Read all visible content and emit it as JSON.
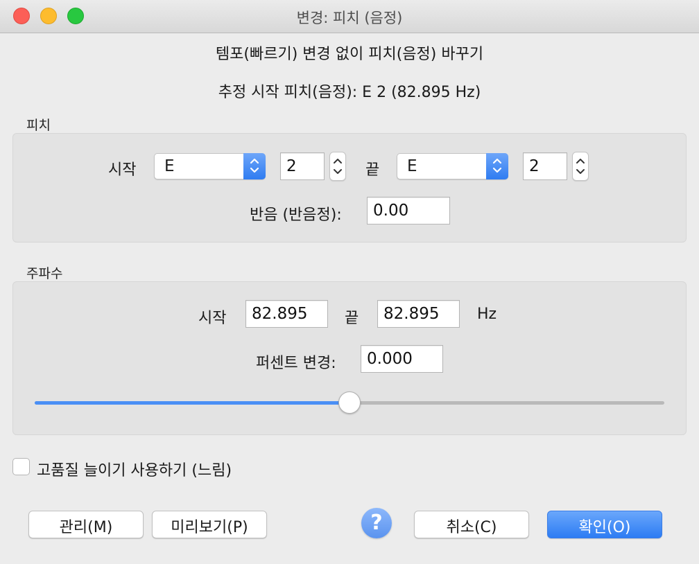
{
  "window": {
    "title": "변경: 피치 (음정)"
  },
  "header": {
    "description": "템포(빠르기) 변경 없이 피치(음정) 바꾸기",
    "estimated_start": "추정 시작 피치(음정): E 2 (82.895 Hz)"
  },
  "pitch": {
    "section_label": "피치",
    "start_label": "시작",
    "start_note": "E",
    "start_octave": "2",
    "end_label": "끝",
    "end_note": "E",
    "end_octave": "2",
    "semitones_label": "반음 (반음정):",
    "semitones_value": "0.00"
  },
  "frequency": {
    "section_label": "주파수",
    "start_label": "시작",
    "start_value": "82.895",
    "end_label": "끝",
    "end_value": "82.895",
    "unit": "Hz",
    "percent_label": "퍼센트 변경:",
    "percent_value": "0.000",
    "slider_level": 0.5
  },
  "options": {
    "high_quality_label": "고품질 늘이기 사용하기 (느림)",
    "high_quality_checked": false
  },
  "buttons": {
    "manage": "관리(M)",
    "preview": "미리보기(P)",
    "help": "?",
    "cancel": "취소(C)",
    "ok": "확인(O)"
  },
  "colors": {
    "accent": "#2f7cf1",
    "close": "#fc5f57",
    "minimize": "#fdbc2e",
    "maximize": "#28c840"
  }
}
